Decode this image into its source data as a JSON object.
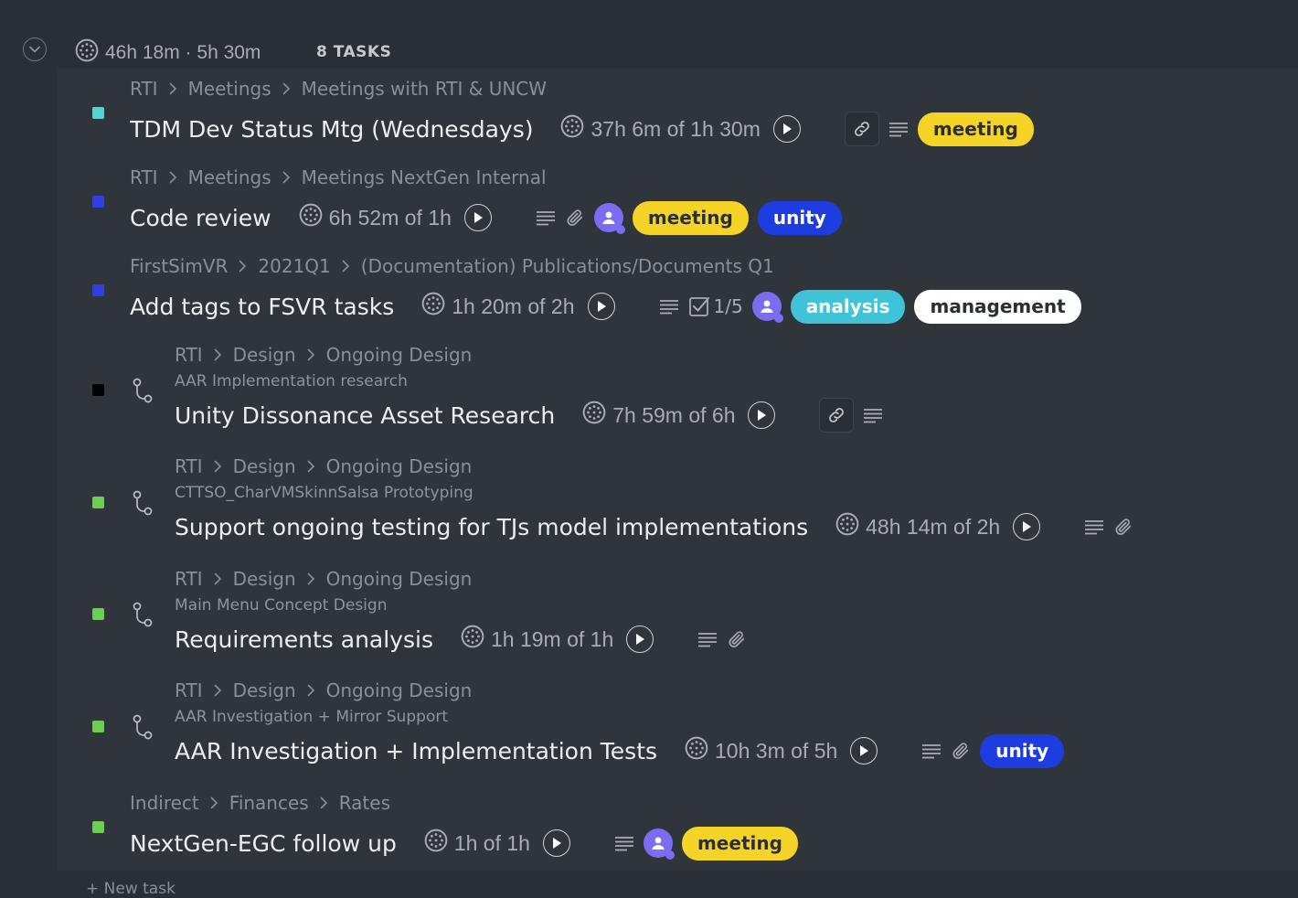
{
  "header": {
    "time": "46h 18m · 5h 30m",
    "count": "8 TASKS"
  },
  "tags": {
    "meeting": {
      "bg": "#f5d327",
      "fg": "#2a2e35"
    },
    "unity": {
      "bg": "#1e3de0",
      "fg": "#ffffff"
    },
    "analysis": {
      "bg": "#3fc3d9",
      "fg": "#ffffff"
    },
    "management": {
      "bg": "#ffffff",
      "fg": "#2a2e35"
    }
  },
  "tasks": [
    {
      "color": "#4fd5d6",
      "subtask": false,
      "breadcrumb": [
        "RTI",
        "Meetings",
        "Meetings with RTI & UNCW"
      ],
      "parent": "",
      "title": "TDM Dev Status Mtg (Wednesdays)",
      "time": "37h 6m of 1h 30m",
      "icons": [
        "link-icon",
        "description-icon"
      ],
      "checklist": "",
      "avatar": false,
      "tags": [
        "meeting"
      ]
    },
    {
      "color": "#2f3ee6",
      "subtask": false,
      "breadcrumb": [
        "RTI",
        "Meetings",
        "Meetings NextGen Internal"
      ],
      "parent": "",
      "title": "Code review",
      "time": "6h 52m of 1h",
      "icons": [
        "description-icon",
        "attachment-icon"
      ],
      "checklist": "",
      "avatar": true,
      "tags": [
        "meeting",
        "unity"
      ]
    },
    {
      "color": "#2f3ee6",
      "subtask": false,
      "breadcrumb": [
        "FirstSimVR",
        "2021Q1",
        "(Documentation) Publications/Documents Q1"
      ],
      "parent": "",
      "title": "Add tags to FSVR tasks",
      "time": "1h 20m of 2h",
      "icons": [
        "description-icon"
      ],
      "checklist": "1/5",
      "avatar": true,
      "tags": [
        "analysis",
        "management"
      ]
    },
    {
      "color": "#000000",
      "subtask": true,
      "breadcrumb": [
        "RTI",
        "Design",
        "Ongoing Design"
      ],
      "parent": "AAR Implementation research",
      "title": "Unity Dissonance Asset Research",
      "time": "7h 59m of 6h",
      "icons": [
        "link-icon",
        "description-icon"
      ],
      "checklist": "",
      "avatar": false,
      "tags": []
    },
    {
      "color": "#6bd04f",
      "subtask": true,
      "breadcrumb": [
        "RTI",
        "Design",
        "Ongoing Design"
      ],
      "parent": "CTTSO_CharVMSkinnSalsa Prototyping",
      "title": "Support ongoing testing for TJs model implementations",
      "time": "48h 14m of 2h",
      "icons": [
        "description-icon",
        "attachment-icon"
      ],
      "checklist": "",
      "avatar": false,
      "tags": []
    },
    {
      "color": "#6bd04f",
      "subtask": true,
      "breadcrumb": [
        "RTI",
        "Design",
        "Ongoing Design"
      ],
      "parent": "Main Menu Concept Design",
      "title": "Requirements analysis",
      "time": "1h 19m of 1h",
      "icons": [
        "description-icon",
        "attachment-icon"
      ],
      "checklist": "",
      "avatar": false,
      "tags": []
    },
    {
      "color": "#6bd04f",
      "subtask": true,
      "breadcrumb": [
        "RTI",
        "Design",
        "Ongoing Design"
      ],
      "parent": "AAR Investigation + Mirror Support",
      "title": "AAR Investigation + Implementation Tests",
      "time": "10h 3m of 5h",
      "icons": [
        "description-icon",
        "attachment-icon"
      ],
      "checklist": "",
      "avatar": false,
      "tags": [
        "unity"
      ]
    },
    {
      "color": "#6bd04f",
      "subtask": false,
      "breadcrumb": [
        "Indirect",
        "Finances",
        "Rates"
      ],
      "parent": "",
      "title": "NextGen-EGC follow up",
      "time": "1h of 1h",
      "icons": [
        "description-icon"
      ],
      "checklist": "",
      "avatar": true,
      "tags": [
        "meeting"
      ]
    }
  ],
  "footer": {
    "new_task": "+ New task"
  }
}
